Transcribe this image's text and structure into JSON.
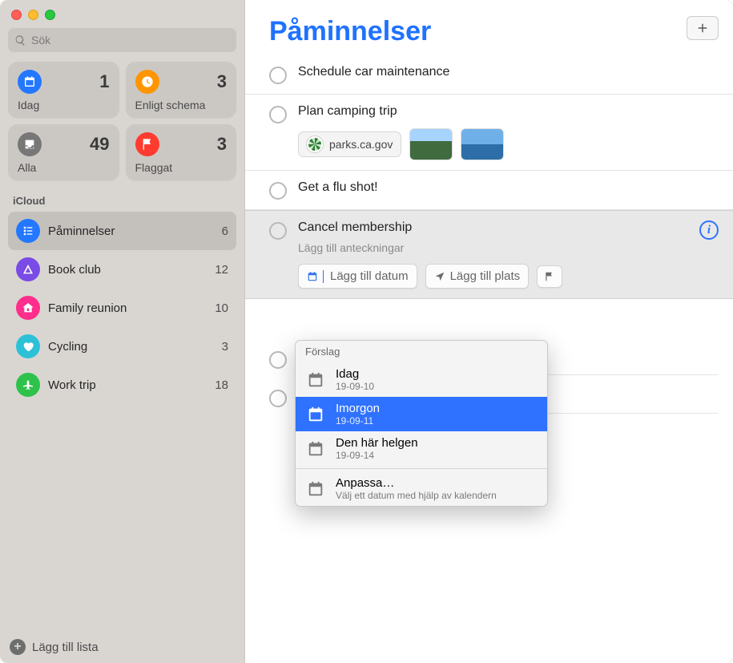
{
  "sidebar": {
    "search_placeholder": "Sök",
    "smart": [
      {
        "label": "Idag",
        "count": "1",
        "color": "sc-blue",
        "icon": "calendar"
      },
      {
        "label": "Enligt schema",
        "count": "3",
        "color": "sc-orange",
        "icon": "clock"
      },
      {
        "label": "Alla",
        "count": "49",
        "color": "sc-gray",
        "icon": "tray"
      },
      {
        "label": "Flaggat",
        "count": "3",
        "color": "sc-red",
        "icon": "flag"
      }
    ],
    "section_title": "iCloud",
    "lists": [
      {
        "name": "Påminnelser",
        "count": "6",
        "color": "#2478ff",
        "icon": "list",
        "selected": true
      },
      {
        "name": "Book club",
        "count": "12",
        "color": "#7a4be6",
        "icon": "tent",
        "selected": false
      },
      {
        "name": "Family reunion",
        "count": "10",
        "color": "#ff2d8b",
        "icon": "house",
        "selected": false
      },
      {
        "name": "Cycling",
        "count": "3",
        "color": "#2cc1d6",
        "icon": "heart",
        "selected": false
      },
      {
        "name": "Work trip",
        "count": "18",
        "color": "#2ec24a",
        "icon": "plane",
        "selected": false
      }
    ],
    "add_list_label": "Lägg till lista"
  },
  "main": {
    "title": "Påminnelser",
    "reminders": [
      {
        "title": "Schedule car maintenance"
      },
      {
        "title": "Plan camping trip",
        "link_label": "parks.ca.gov"
      },
      {
        "title": "Get a flu shot!"
      },
      {
        "title": "Cancel membership",
        "notes_placeholder": "Lägg till anteckningar",
        "editing": true
      }
    ],
    "chips": {
      "date_label": "Lägg till datum",
      "place_label": "Lägg till plats"
    },
    "popover": {
      "title": "Förslag",
      "items": [
        {
          "label": "Idag",
          "sub": "19-09-10",
          "selected": false
        },
        {
          "label": "Imorgon",
          "sub": "19-09-11",
          "selected": true
        },
        {
          "label": "Den här helgen",
          "sub": "19-09-14",
          "selected": false
        }
      ],
      "custom": {
        "label": "Anpassa…",
        "sub": "Välj ett datum med hjälp av kalendern"
      }
    }
  }
}
